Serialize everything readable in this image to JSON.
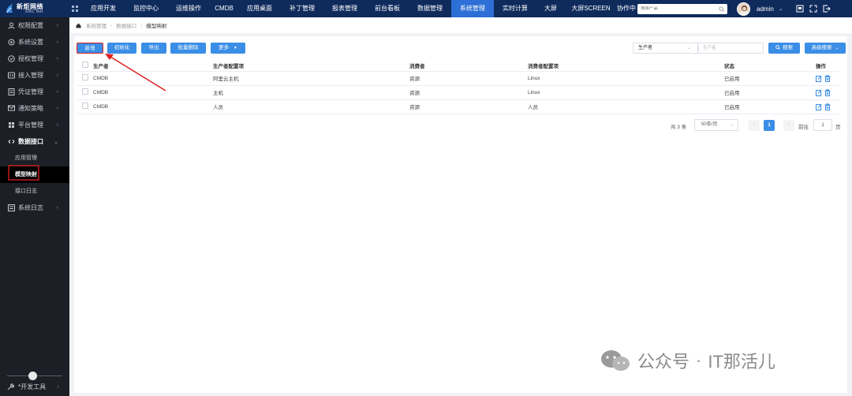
{
  "brand": {
    "title": "新炬网络",
    "subtitle": "SNC Net"
  },
  "nav": [
    "应用开发",
    "监控中心",
    "运维操作",
    "CMDB",
    "应用桌面",
    "补丁管理",
    "报表管理",
    "前台看板",
    "数据管理",
    "系统管理",
    "实时计算",
    "大屏",
    "大屏SCREEN",
    "协作中"
  ],
  "nav_active_index": 9,
  "search": {
    "placeholder": "搜索产品"
  },
  "user": {
    "name": "admin"
  },
  "sidebar": {
    "items": [
      {
        "label": "权限配置",
        "icon": "user-icon"
      },
      {
        "label": "系统设置",
        "icon": "gear-icon"
      },
      {
        "label": "授权管理",
        "icon": "license-icon"
      },
      {
        "label": "接入管理",
        "icon": "access-icon"
      },
      {
        "label": "凭证管理",
        "icon": "credential-icon"
      },
      {
        "label": "通知策略",
        "icon": "notify-icon"
      },
      {
        "label": "平台管理",
        "icon": "platform-icon"
      },
      {
        "label": "数据接口",
        "icon": "interface-icon"
      }
    ],
    "sub_items": [
      "应用管理",
      "模型映射",
      "接口日志"
    ],
    "sub_active_index": 1,
    "after": {
      "label": "系统日志",
      "icon": "log-icon"
    },
    "bottom": {
      "label": "*开发工具"
    }
  },
  "breadcrumb": [
    "系统管理",
    "数据接口",
    "模型映射"
  ],
  "toolbar": {
    "add": "新增",
    "init": "初始化",
    "export": "导出",
    "batch_delete": "批量删除",
    "more": "更多",
    "filter_field": "生产者",
    "filter_placeholder": "生产者",
    "search": "搜索",
    "advanced": "高级搜索"
  },
  "table": {
    "headers": [
      "生产者",
      "生产者配置项",
      "消费者",
      "消费者配置项",
      "状态",
      "操作"
    ],
    "rows": [
      [
        "CMDB",
        "阿里云主机",
        "资源",
        "Linux",
        "已启用"
      ],
      [
        "CMDB",
        "主机",
        "资源",
        "Linux",
        "已启用"
      ],
      [
        "CMDB",
        "人员",
        "资源",
        "人员",
        "已启用"
      ]
    ]
  },
  "pagination": {
    "total": "共 3 条",
    "page_size": "50条/页",
    "current_page": "1",
    "goto_label": "前往",
    "goto_value": "1",
    "page_suffix": "页"
  },
  "watermark": {
    "text_a": "公众号",
    "dot": "·",
    "text_b": "IT那活儿"
  },
  "colors": {
    "topbar": "#0f2b5c",
    "active_nav": "#2d6fd6",
    "primary": "#3a8ee6",
    "sidebar": "#1c1f26",
    "highlight": "#e02020"
  }
}
